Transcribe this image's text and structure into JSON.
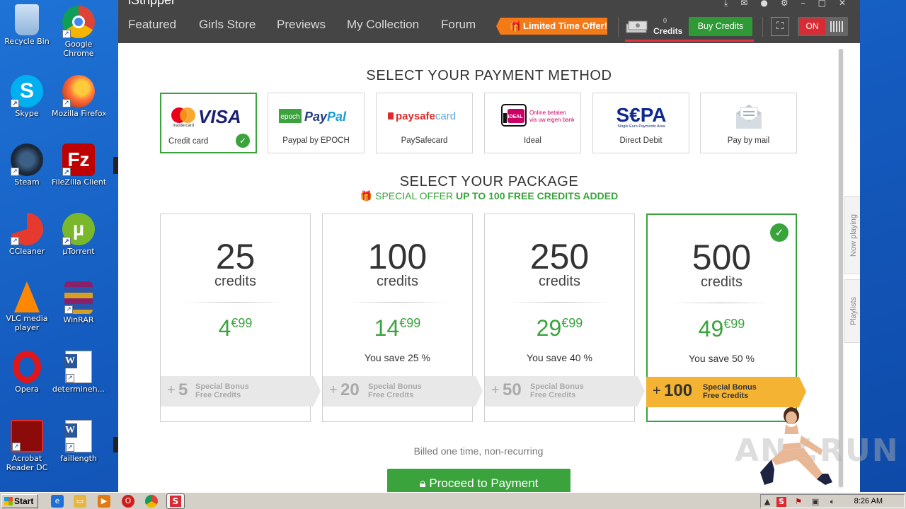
{
  "desktop": {
    "icons": [
      {
        "label": "Recycle Bin"
      },
      {
        "label": "Google Chrome"
      },
      {
        "label": "Skype"
      },
      {
        "label": "Mozilla Firefox"
      },
      {
        "label": "Steam"
      },
      {
        "label": "FileZilla Client"
      },
      {
        "label": "CCleaner"
      },
      {
        "label": "µTorrent"
      },
      {
        "label": "VLC media player"
      },
      {
        "label": "WinRAR"
      },
      {
        "label": "Opera"
      },
      {
        "label": "determineh..."
      },
      {
        "label": "Acrobat Reader DC"
      },
      {
        "label": "faillength"
      }
    ]
  },
  "app": {
    "title": "iStripper",
    "nav": [
      "Featured",
      "Girls Store",
      "Previews",
      "My Collection",
      "Forum"
    ],
    "offer_button": "Limited Time Offer!",
    "credits_count": "0",
    "credits_label": "Credits",
    "buy_button": "Buy Credits",
    "toggle_label": "ON",
    "accent_color": "#3aa33c",
    "offer_color": "#f47a18"
  },
  "payment": {
    "heading": "SELECT YOUR PAYMENT METHOD",
    "selected_index": 0,
    "methods": [
      {
        "name": "Credit card",
        "logo_text": "VISA",
        "sub_logo": "mastercard"
      },
      {
        "name": "Paypal by EPOCH",
        "logo_text": "PayPal",
        "sub_logo": "epoch"
      },
      {
        "name": "PaySafecard",
        "logo_text": "paysafecard",
        "sub_logo": ""
      },
      {
        "name": "Ideal",
        "logo_text": "iDEAL",
        "sub_logo": "Online betalen via uw eigen bank"
      },
      {
        "name": "Direct Debit",
        "logo_text": "SEPA",
        "sub_logo": "Single Euro Payments Area"
      },
      {
        "name": "Pay by mail",
        "logo_text": "",
        "sub_logo": ""
      }
    ]
  },
  "package": {
    "heading": "SELECT YOUR PACKAGE",
    "offer_prefix": "SPECIAL OFFER",
    "offer_bold": "UP TO 100 FREE CREDITS ADDED",
    "unit": "credits",
    "selected_index": 3,
    "items": [
      {
        "amount": "25",
        "price_int": "4",
        "price_dec": "€99",
        "save": "",
        "bonus": "5",
        "bonus_line1": "Special Bonus",
        "bonus_line2": "Free Credits"
      },
      {
        "amount": "100",
        "price_int": "14",
        "price_dec": "€99",
        "save": "You save 25 %",
        "bonus": "20",
        "bonus_line1": "Special Bonus",
        "bonus_line2": "Free Credits"
      },
      {
        "amount": "250",
        "price_int": "29",
        "price_dec": "€99",
        "save": "You save 40 %",
        "bonus": "50",
        "bonus_line1": "Special Bonus",
        "bonus_line2": "Free Credits"
      },
      {
        "amount": "500",
        "price_int": "49",
        "price_dec": "€99",
        "save": "You save 50 %",
        "bonus": "100",
        "bonus_line1": "Special Bonus",
        "bonus_line2": "Free Credits"
      }
    ],
    "billed_note": "Billed one time, non-recurring",
    "proceed_button": "Proceed to Payment"
  },
  "side_tabs": [
    "Now playing",
    "Playlists"
  ],
  "watermark": "ANY.RUN",
  "taskbar": {
    "start_label": "Start",
    "clock": "8:26 AM"
  }
}
